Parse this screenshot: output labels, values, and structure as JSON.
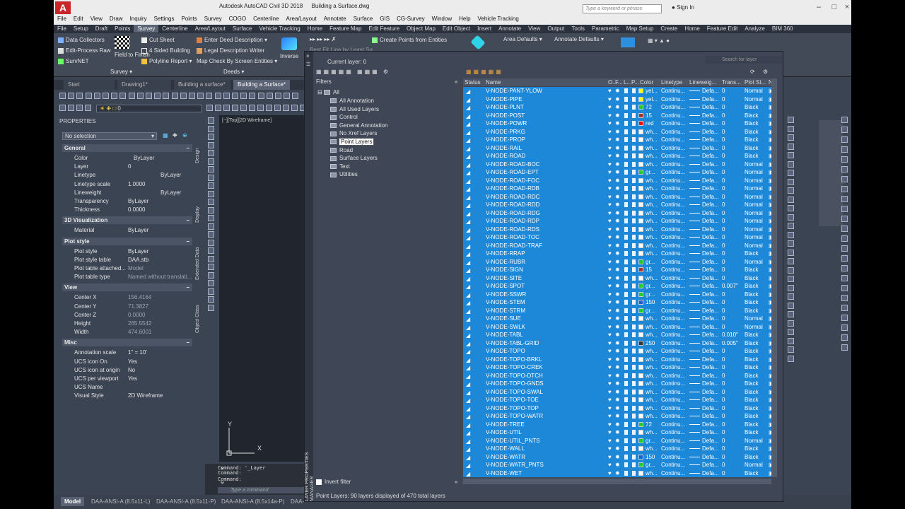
{
  "titlebar": {
    "app": "Autodesk AutoCAD Civil 3D 2018",
    "file": "Building a Surface.dwg",
    "search_placeholder": "Type a keyword or phrase",
    "signin": "Sign In"
  },
  "menubar": [
    "File",
    "Edit",
    "View",
    "Draw",
    "Inquiry",
    "Settings",
    "Points",
    "Survey",
    "COGO",
    "Centerline",
    "Area/Layout",
    "Annotate",
    "Surface",
    "GIS",
    "CG-Survey",
    "Window",
    "Help",
    "Vehicle Tracking"
  ],
  "ribbon_tabs": [
    "File",
    "Setup",
    "Draft",
    "Points",
    "Survey",
    "Centerline",
    "Area/Layout",
    "Surface",
    "Vehicle Tracking",
    "Home",
    "Feature Map",
    "Edit Feature",
    "Object Map",
    "Edit Object",
    "Insert",
    "Annotate",
    "View",
    "Output",
    "Tools",
    "Parametric",
    "Map Setup",
    "Create",
    "Home",
    "Feature Edit",
    "Analyze",
    "BIM 360"
  ],
  "ribbon_active": "Survey",
  "ribbon": {
    "data_collectors": "Data Collectors",
    "edit_process_raw": "Edit-Process Raw",
    "survnet": "SurvNET",
    "field_to_finish": "Field to Finish",
    "cut_sheet": "Cut Sheet",
    "four_sided_building": "4 Sided Building",
    "polyline_report": "Polyline Report",
    "enter_deed": "Enter Deed Description",
    "legal_desc_writer": "Legal Description Writer",
    "map_check": "Map Check By Screen Entities",
    "inverse": "Inverse",
    "create_points": "Create Points from Entities",
    "best_fit": "Best Fit Line by Least Sq",
    "area_defaults": "Area Defaults",
    "annotate_defaults": "Annotate Defaults",
    "panel_survey": "Survey",
    "panel_deeds": "Deeds"
  },
  "doc_tabs": [
    {
      "label": "Start",
      "active": false
    },
    {
      "label": "Drawing1*",
      "active": false
    },
    {
      "label": "Building a surface*",
      "active": false
    },
    {
      "label": "Building a Surface*",
      "active": true
    }
  ],
  "layer_dropdown": "0",
  "properties": {
    "title": "PROPERTIES",
    "selection": "No selection",
    "sections": [
      {
        "name": "General",
        "rows": [
          [
            "Color",
            "ByLayer"
          ],
          [
            "Layer",
            "0"
          ],
          [
            "Linetype",
            "ByLayer"
          ],
          [
            "Linetype scale",
            "1.0000"
          ],
          [
            "Lineweight",
            "ByLayer"
          ],
          [
            "Transparency",
            "ByLayer"
          ],
          [
            "Thickness",
            "0.0000"
          ]
        ]
      },
      {
        "name": "3D Visualization",
        "rows": [
          [
            "Material",
            "ByLayer"
          ]
        ]
      },
      {
        "name": "Plot style",
        "rows": [
          [
            "Plot style",
            "ByLayer"
          ],
          [
            "Plot style table",
            "DAA.stb"
          ],
          [
            "Plot table attached...",
            "Model"
          ],
          [
            "Plot table type",
            "Named without translati..."
          ]
        ]
      },
      {
        "name": "View",
        "rows": [
          [
            "Center X",
            "156.4164"
          ],
          [
            "Center Y",
            "71.3827"
          ],
          [
            "Center Z",
            "0.0000"
          ],
          [
            "Height",
            "265.5542"
          ],
          [
            "Width",
            "474.6001"
          ]
        ]
      },
      {
        "name": "Misc",
        "rows": [
          [
            "Annotation scale",
            "1\" = 10'"
          ],
          [
            "UCS icon On",
            "Yes"
          ],
          [
            "UCS icon at origin",
            "No"
          ],
          [
            "UCS per viewport",
            "Yes"
          ],
          [
            "UCS Name",
            ""
          ],
          [
            "Visual Style",
            "2D Wireframe"
          ]
        ]
      }
    ],
    "side_tabs": [
      "Design",
      "Display",
      "Extended Data",
      "Object Class"
    ]
  },
  "viewport_label": "[−][Top][2D Wireframe]",
  "ucs": {
    "x": "X",
    "y": "Y"
  },
  "command_history": [
    "Command: '_Layer",
    "Command:",
    "Command:"
  ],
  "command_placeholder": "Type a command",
  "layouts": [
    "Model",
    "DAA-ANSI-A (8.5x11-L)",
    "DAA-ANSI-A (8.5x11-P)",
    "DAA-ANSI-A (8.5x14a-P)",
    "DAA-"
  ],
  "layer_manager": {
    "side_label": "LAYER PROPERTIES MANAGER",
    "current_layer": "Current layer: 0",
    "search_placeholder": "Search for layer",
    "filters_label": "Filters",
    "filter_root": "All",
    "filters": [
      "All Annotation",
      "All Used Layers",
      "Control",
      "General Annotation",
      "No Xref Layers",
      "Point Layers",
      "Road",
      "Surface Layers",
      "Text",
      "Utilities"
    ],
    "selected_filter": "Point Layers",
    "invert_filter": "Invert filter",
    "status": "Point Layers: 90 layers displayed of 470 total layers",
    "columns": [
      "Status",
      "Name",
      "O...",
      "F...",
      "L...",
      "P...",
      "Color",
      "Linetype",
      "Lineweig...",
      "Trans...",
      "Plot St...",
      "N"
    ],
    "layers": [
      {
        "name": "V-NODE-PANT-YLOW",
        "color": "yel...",
        "hex": "#ffff00",
        "trans": "0",
        "plot": "Normal"
      },
      {
        "name": "V-NODE-PIPE",
        "color": "yel...",
        "hex": "#ffff00",
        "trans": "0",
        "plot": "Normal"
      },
      {
        "name": "V-NODE-PLNT",
        "color": "72",
        "hex": "#22cc22",
        "trans": "0",
        "plot": "Black"
      },
      {
        "name": "V-NODE-POST",
        "color": "15",
        "hex": "#a83030",
        "trans": "0",
        "plot": "Black"
      },
      {
        "name": "V-NODE-POWR",
        "color": "red",
        "hex": "#ff0000",
        "trans": "0",
        "plot": "Black"
      },
      {
        "name": "V-NODE-PRKG",
        "color": "wh...",
        "hex": "#ffffff",
        "trans": "0",
        "plot": "Black"
      },
      {
        "name": "V-NODE-PROP",
        "color": "wh...",
        "hex": "#ffffff",
        "trans": "0",
        "plot": "Black"
      },
      {
        "name": "V-NODE-RAIL",
        "color": "wh...",
        "hex": "#ffffff",
        "trans": "0",
        "plot": "Black"
      },
      {
        "name": "V-NODE-ROAD",
        "color": "wh...",
        "hex": "#ffffff",
        "trans": "0",
        "plot": "Black"
      },
      {
        "name": "V-NODE-ROAD-BOC",
        "color": "wh...",
        "hex": "#ffffff",
        "trans": "0",
        "plot": "Normal"
      },
      {
        "name": "V-NODE-ROAD-EPT",
        "color": "gr...",
        "hex": "#22cc22",
        "trans": "0",
        "plot": "Normal"
      },
      {
        "name": "V-NODE-ROAD-FOC",
        "color": "wh...",
        "hex": "#ffffff",
        "trans": "0",
        "plot": "Normal"
      },
      {
        "name": "V-NODE-ROAD-RDB",
        "color": "wh...",
        "hex": "#ffffff",
        "trans": "0",
        "plot": "Normal"
      },
      {
        "name": "V-NODE-ROAD-RDC",
        "color": "wh...",
        "hex": "#ffffff",
        "trans": "0",
        "plot": "Normal"
      },
      {
        "name": "V-NODE-ROAD-RDD",
        "color": "wh...",
        "hex": "#ffffff",
        "trans": "0",
        "plot": "Normal"
      },
      {
        "name": "V-NODE-ROAD-RDG",
        "color": "wh...",
        "hex": "#ffffff",
        "trans": "0",
        "plot": "Normal"
      },
      {
        "name": "V-NODE-ROAD-RDP",
        "color": "wh...",
        "hex": "#ffffff",
        "trans": "0",
        "plot": "Normal"
      },
      {
        "name": "V-NODE-ROAD-RDS",
        "color": "wh...",
        "hex": "#ffffff",
        "trans": "0",
        "plot": "Normal"
      },
      {
        "name": "V-NODE-ROAD-TOC",
        "color": "wh...",
        "hex": "#ffffff",
        "trans": "0",
        "plot": "Normal"
      },
      {
        "name": "V-NODE-ROAD-TRAF",
        "color": "wh...",
        "hex": "#ffffff",
        "trans": "0",
        "plot": "Normal"
      },
      {
        "name": "V-NODE-RRAP",
        "color": "wh...",
        "hex": "#ffffff",
        "trans": "0",
        "plot": "Black"
      },
      {
        "name": "V-NODE-RUBR",
        "color": "gr...",
        "hex": "#22cc22",
        "trans": "0",
        "plot": "Normal"
      },
      {
        "name": "V-NODE-SIGN",
        "color": "15",
        "hex": "#a83030",
        "trans": "0",
        "plot": "Black"
      },
      {
        "name": "V-NODE-SITE",
        "color": "wh...",
        "hex": "#ffffff",
        "trans": "0",
        "plot": "Black"
      },
      {
        "name": "V-NODE-SPOT",
        "color": "gr...",
        "hex": "#22cc22",
        "trans": "0.007\"",
        "plot": "Black"
      },
      {
        "name": "V-NODE-SSWR",
        "color": "gr...",
        "hex": "#22cc22",
        "trans": "0",
        "plot": "Black"
      },
      {
        "name": "V-NODE-STEM",
        "color": "150",
        "hex": "#1f5fd0",
        "trans": "0",
        "plot": "Black"
      },
      {
        "name": "V-NODE-STRM",
        "color": "gr...",
        "hex": "#22cc22",
        "trans": "0",
        "plot": "Black"
      },
      {
        "name": "V-NODE-SUE",
        "color": "wh...",
        "hex": "#ffffff",
        "trans": "0",
        "plot": "Normal"
      },
      {
        "name": "V-NODE-SWLK",
        "color": "wh...",
        "hex": "#ffffff",
        "trans": "0",
        "plot": "Normal"
      },
      {
        "name": "V-NODE-TABL",
        "color": "wh...",
        "hex": "#ffffff",
        "trans": "0.010\"",
        "plot": "Black"
      },
      {
        "name": "V-NODE-TABL-GRID",
        "color": "250",
        "hex": "#333333",
        "trans": "0.005\"",
        "plot": "Black"
      },
      {
        "name": "V-NODE-TOPO",
        "color": "wh...",
        "hex": "#ffffff",
        "trans": "0",
        "plot": "Black"
      },
      {
        "name": "V-NODE-TOPO-BRKL",
        "color": "wh...",
        "hex": "#ffffff",
        "trans": "0",
        "plot": "Black"
      },
      {
        "name": "V-NODE-TOPO-CREK",
        "color": "wh...",
        "hex": "#ffffff",
        "trans": "0",
        "plot": "Black"
      },
      {
        "name": "V-NODE-TOPO-DTCH",
        "color": "wh...",
        "hex": "#ffffff",
        "trans": "0",
        "plot": "Black"
      },
      {
        "name": "V-NODE-TOPO-GNDS",
        "color": "wh...",
        "hex": "#ffffff",
        "trans": "0",
        "plot": "Black"
      },
      {
        "name": "V-NODE-TOPO-SWAL",
        "color": "wh...",
        "hex": "#ffffff",
        "trans": "0",
        "plot": "Black"
      },
      {
        "name": "V-NODE-TOPO-TOE",
        "color": "wh...",
        "hex": "#ffffff",
        "trans": "0",
        "plot": "Black"
      },
      {
        "name": "V-NODE-TOPO-TOP",
        "color": "wh...",
        "hex": "#ffffff",
        "trans": "0",
        "plot": "Black"
      },
      {
        "name": "V-NODE-TOPO-WATR",
        "color": "wh...",
        "hex": "#ffffff",
        "trans": "0",
        "plot": "Black"
      },
      {
        "name": "V-NODE-TREE",
        "color": "72",
        "hex": "#22cc22",
        "trans": "0",
        "plot": "Black"
      },
      {
        "name": "V-NODE-UTIL",
        "color": "wh...",
        "hex": "#ffffff",
        "trans": "0",
        "plot": "Black"
      },
      {
        "name": "V-NODE-UTIL_PNTS",
        "color": "gr...",
        "hex": "#22cc22",
        "trans": "0",
        "plot": "Normal"
      },
      {
        "name": "V-NODE-WALL",
        "color": "wh...",
        "hex": "#ffffff",
        "trans": "0",
        "plot": "Black"
      },
      {
        "name": "V-NODE-WATR",
        "color": "150",
        "hex": "#1f5fd0",
        "trans": "0",
        "plot": "Black"
      },
      {
        "name": "V-NODE-WATR_PNTS",
        "color": "gr...",
        "hex": "#22cc22",
        "trans": "0",
        "plot": "Normal"
      },
      {
        "name": "V-NODE-WET",
        "color": "wh...",
        "hex": "#ffffff",
        "trans": "0",
        "plot": "Black"
      }
    ],
    "linetype": "Continu...",
    "lineweight": "Defa..."
  },
  "colors": {
    "app_bg": "#3b4453",
    "selection": "#1e88d8",
    "brand_red": "#c8262b"
  }
}
